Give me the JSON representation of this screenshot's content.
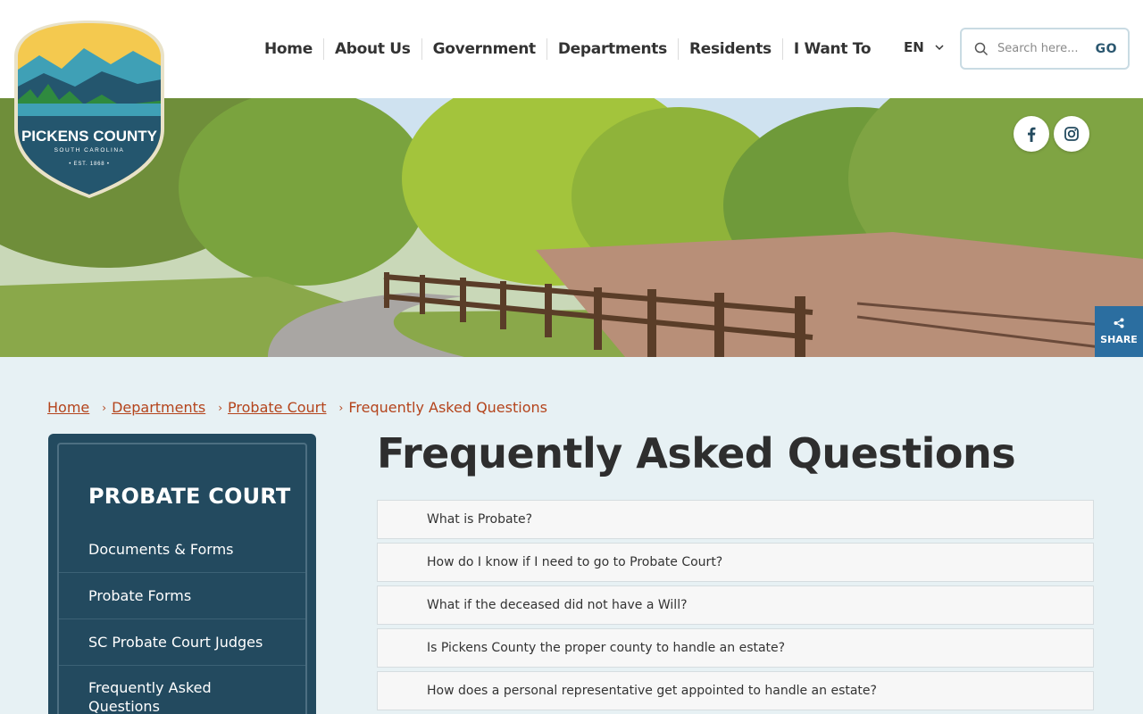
{
  "logo": {
    "name": "PICKENS COUNTY",
    "state": "SOUTH CAROLINA",
    "est": "• EST. 1868 •"
  },
  "nav": {
    "items": [
      "Home",
      "About Us",
      "Government",
      "Departments",
      "Residents",
      "I Want To"
    ]
  },
  "lang": {
    "code": "EN"
  },
  "search": {
    "placeholder": "Search here...",
    "go": "GO"
  },
  "social": {
    "facebook": "facebook-icon",
    "instagram": "instagram-icon"
  },
  "share": {
    "label": "SHARE"
  },
  "breadcrumb": {
    "items": [
      "Home",
      "Departments",
      "Probate Court"
    ],
    "current": "Frequently Asked Questions"
  },
  "sidenav": {
    "title": "PROBATE COURT",
    "items": [
      "Documents & Forms",
      "Probate Forms",
      "SC Probate Court Judges",
      "Frequently Asked Questions"
    ]
  },
  "main": {
    "title": "Frequently Asked Questions",
    "faq": [
      "What is Probate?",
      "How do I know if I need to go to Probate Court?",
      "What if the deceased did not have a Will?",
      "Is Pickens County the proper county to handle an estate?",
      "How does a personal representative get appointed to handle an estate?"
    ]
  },
  "colors": {
    "accent": "#b4441c",
    "sidenav": "#234a5f",
    "share": "#2b6ea0",
    "background": "#e7f1f4"
  }
}
